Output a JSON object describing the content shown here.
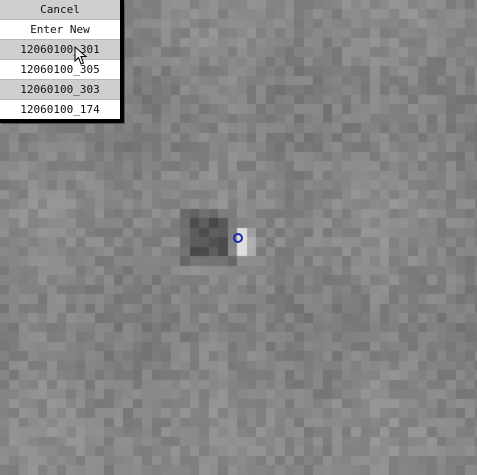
{
  "menu": {
    "items": [
      {
        "label": "Cancel"
      },
      {
        "label": "Enter New"
      },
      {
        "label": "12060100_301"
      },
      {
        "label": "12060100_305"
      },
      {
        "label": "12060100_303"
      },
      {
        "label": "12060100_174"
      }
    ]
  },
  "image": {
    "kind": "grayscale-astronomy-cutout",
    "background_color": "#8a8a8a"
  },
  "marker": {
    "shape": "circle",
    "color": "#1f2aa8",
    "icon": "target-circle-icon"
  },
  "cursor": {
    "icon": "mouse-pointer-icon"
  }
}
